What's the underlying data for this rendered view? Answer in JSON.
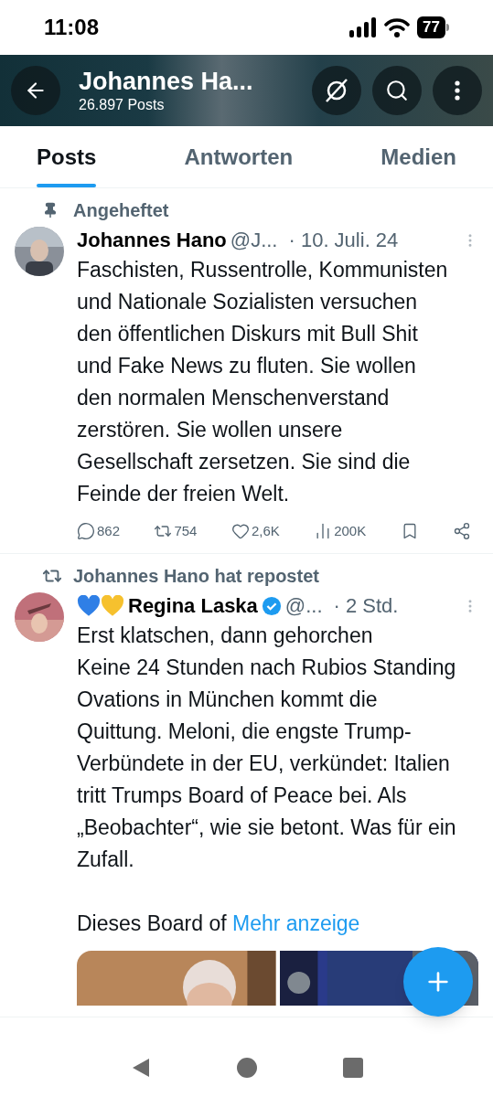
{
  "status_bar": {
    "time": "11:08",
    "battery": "77"
  },
  "header": {
    "title": "Johannes Ha...",
    "subtitle": "26.897 Posts"
  },
  "tabs": [
    {
      "label": "Posts",
      "selected": true
    },
    {
      "label": "Antworten",
      "selected": false
    },
    {
      "label": "Medien",
      "selected": false
    }
  ],
  "posts": [
    {
      "context": {
        "kind": "pinned",
        "text": "Angeheftet"
      },
      "name": "Johannes Hano",
      "handle": "@J...",
      "time": "· 10. Juli. 24",
      "text": "Faschisten, Russentrolle, Kommunisten und Nationale Sozialisten versuchen den öffentlichen Diskurs mit Bull Shit und Fake News zu fluten. Sie wollen den normalen Menschenverstand zerstören. Sie wollen unsere Gesellschaft zersetzen. Sie sind die Feinde der freien Welt.",
      "actions": [
        {
          "kind": "reply",
          "count": "862"
        },
        {
          "kind": "repost",
          "count": "754"
        },
        {
          "kind": "like",
          "count": "2,6K"
        },
        {
          "kind": "views",
          "count": "200K"
        },
        {
          "kind": "bookmark"
        },
        {
          "kind": "share"
        }
      ]
    },
    {
      "context": {
        "kind": "repost",
        "text": "Johannes Hano hat repostet"
      },
      "name": "Regina Laska",
      "emoji_prefix": true,
      "verified": true,
      "handle": "@...",
      "time": "· 2 Std.",
      "text": "Erst klatschen, dann gehorchen\nKeine 24 Stunden nach Rubios Standing Ovations in München kommt die Quittung. Meloni, die engste Trump-Verbündete in der EU, verkündet: Italien tritt Trumps Board of Peace bei. Als „Beobachter“, wie sie betont. Was für ein Zufall.\n\nDieses Board of",
      "more": "Mehr anzeige",
      "media": true
    }
  ]
}
